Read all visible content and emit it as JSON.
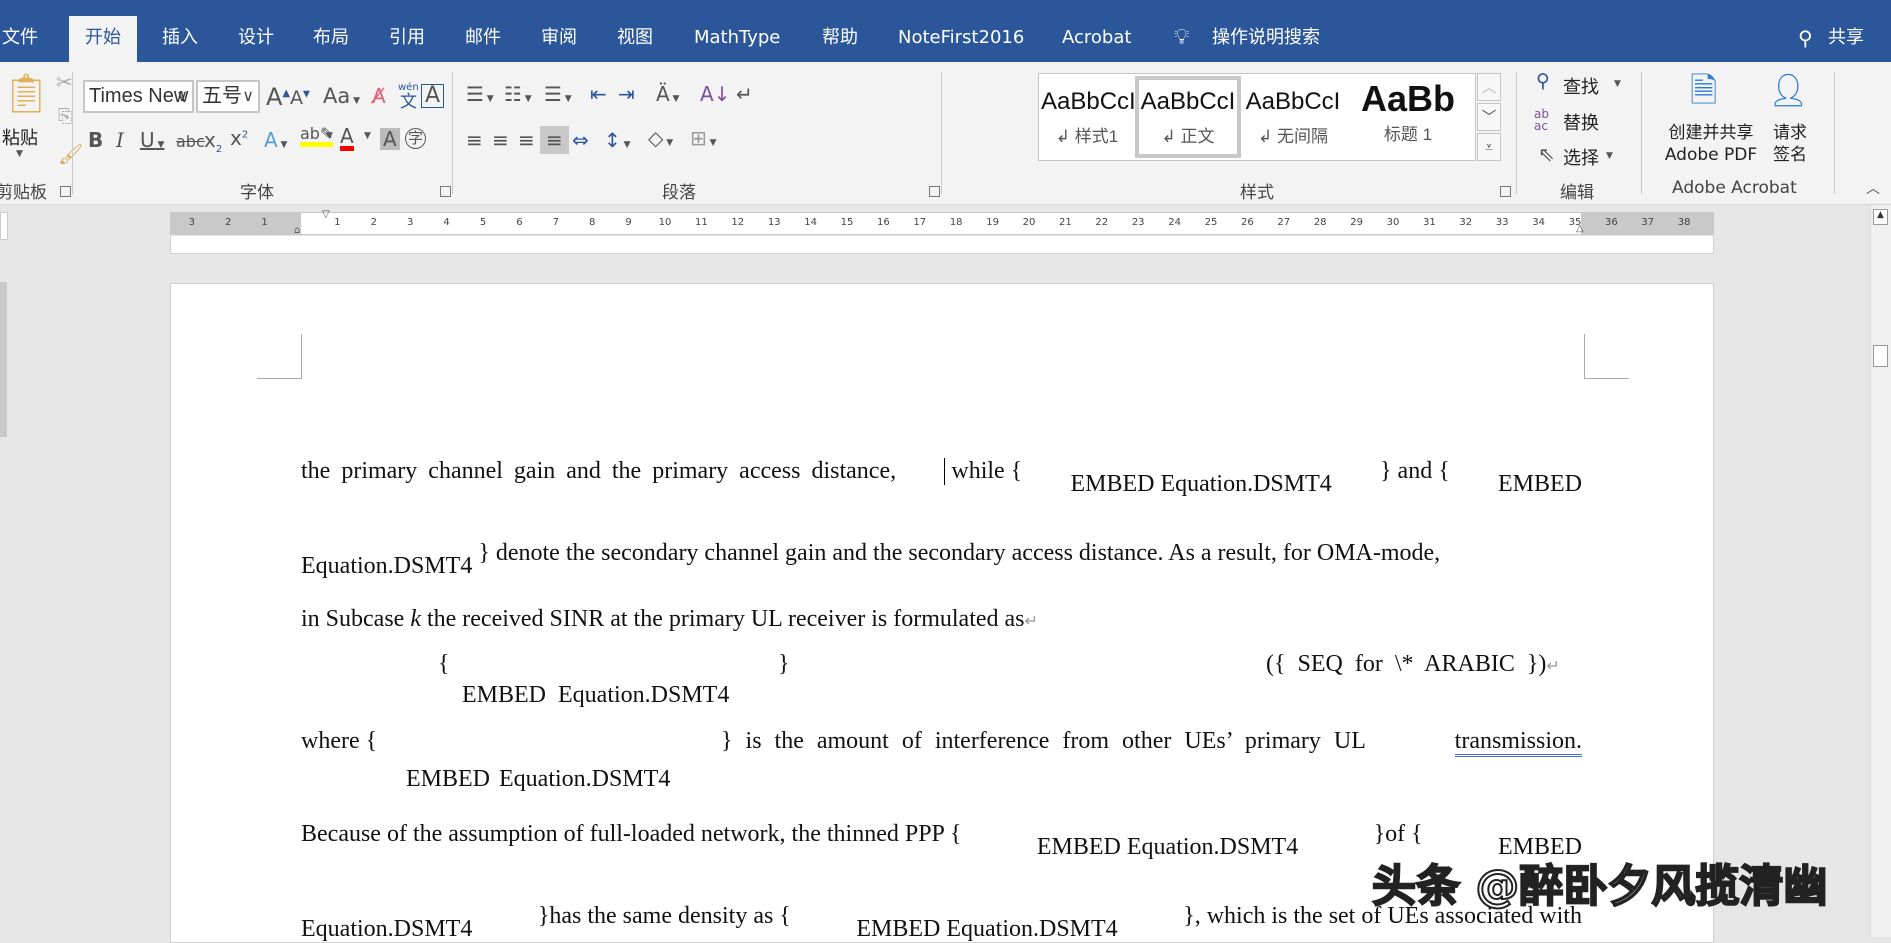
{
  "tabs": [
    "文件",
    "开始",
    "插入",
    "设计",
    "布局",
    "引用",
    "邮件",
    "审阅",
    "视图",
    "MathType",
    "帮助",
    "NoteFirst2016",
    "Acrobat"
  ],
  "active_tab": "开始",
  "tell_me": "操作说明搜索",
  "share": "共享",
  "clipboard": {
    "paste": "粘贴",
    "label": "剪贴板"
  },
  "font": {
    "name": "Times New R",
    "size": "五号",
    "label": "字体",
    "phonetic": "wén"
  },
  "paragraph": {
    "label": "段落"
  },
  "styles": {
    "label": "样式",
    "items": [
      {
        "sample": "AaBbCcI",
        "name": "样式1"
      },
      {
        "sample": "AaBbCcI",
        "name": "正文",
        "selected": true
      },
      {
        "sample": "AaBbCcI",
        "name": "无间隔"
      },
      {
        "sample": "AaBb",
        "name": "标题 1"
      }
    ]
  },
  "editing": {
    "find": "查找",
    "replace": "替换",
    "select": "选择",
    "label": "编辑"
  },
  "acrobat": {
    "create": "创建并共享",
    "create2": "Adobe PDF",
    "sign": "请求",
    "sign2": "签名",
    "label": "Adobe Acrobat"
  },
  "ruler": {
    "left": [
      "3",
      "2",
      "1"
    ],
    "main": [
      "1",
      "2",
      "3",
      "4",
      "5",
      "6",
      "7",
      "8",
      "9",
      "10",
      "11",
      "12",
      "13",
      "14",
      "15",
      "16",
      "17",
      "18",
      "19",
      "20",
      "21",
      "22",
      "23",
      "24",
      "25",
      "26",
      "27",
      "28",
      "29",
      "30",
      "31",
      "32",
      "33",
      "34",
      "35"
    ],
    "right": [
      "36",
      "37",
      "38"
    ]
  },
  "doc": {
    "l1a": "the primary channel gain and the primary access distance,",
    "l1b": "while {",
    "l1c": "EMBED Equation.DSMT4",
    "l1d": "} and {",
    "l1e": "EMBED",
    "l2a": "Equation.DSMT4",
    "l2b": "} denote the secondary channel gain and the secondary access distance. As a result, for OMA-mode,",
    "l3a": "in Subcase ",
    "l3k": "k",
    "l3b": " the received SINR at the primary UL receiver is formulated as",
    "l4a": "{",
    "l4b": "}",
    "l4c": "({ SEQ for \\* ARABIC })",
    "l5": "EMBED Equation.DSMT4",
    "l6a": "where {",
    "l6b": "} is the amount of interference from other UEs’ primary UL",
    "l6c": "transmission.",
    "l7": "EMBED Equation.DSMT4",
    "l8a": "Because of the assumption of full-loaded network, the thinned PPP {",
    "l8b": "EMBED Equation.DSMT4",
    "l8c": "}of {",
    "l8d": "EMBED",
    "l9a": "Equation.DSMT4",
    "l9b": "}has the same density as {",
    "l9c": "EMBED Equation.DSMT4",
    "l9d": "}, which is the set of UEs associated with"
  },
  "watermark": "头条 @醉卧夕风揽清幽",
  "colors": {
    "tabbar": "#2b579a",
    "ribbon": "#f3f3f3",
    "highlight": "#ffff00",
    "font_color": "#ff0000"
  }
}
